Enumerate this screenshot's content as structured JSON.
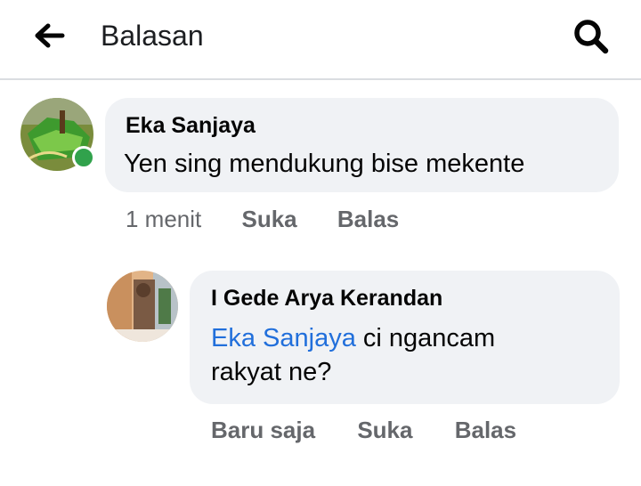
{
  "header": {
    "title": "Balasan",
    "back_icon": "arrow-left-icon",
    "search_icon": "search-icon"
  },
  "comment": {
    "author": "Eka Sanjaya",
    "text": "Yen sing mendukung bise mekente",
    "time": "1 menit",
    "like_label": "Suka",
    "reply_label": "Balas",
    "online": true
  },
  "reply": {
    "author": "I Gede Arya Kerandan",
    "mention": "Eka Sanjaya",
    "text_line1": " ci ngancam",
    "text_line2": "rakyat ne?",
    "time": "Baru saja",
    "like_label": "Suka",
    "reply_label": "Balas"
  },
  "colors": {
    "bubble": "#f0f2f5",
    "mention": "#216fdb",
    "online": "#31a24c",
    "meta": "#65676b"
  }
}
